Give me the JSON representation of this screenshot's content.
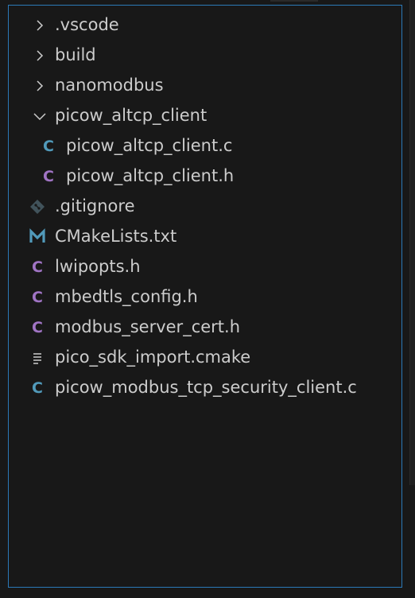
{
  "explorer": {
    "items": [
      {
        "label": ".vscode",
        "kind": "folder",
        "expanded": false,
        "depth": 0,
        "icon": "chevron-right-icon"
      },
      {
        "label": "build",
        "kind": "folder",
        "expanded": false,
        "depth": 0,
        "icon": "chevron-right-icon"
      },
      {
        "label": "nanomodbus",
        "kind": "folder",
        "expanded": false,
        "depth": 0,
        "icon": "chevron-right-icon"
      },
      {
        "label": "picow_altcp_client",
        "kind": "folder",
        "expanded": true,
        "depth": 0,
        "icon": "chevron-down-icon"
      },
      {
        "label": "picow_altcp_client.c",
        "kind": "file",
        "depth": 1,
        "icon": "c-file-icon",
        "icon_color": "#519aba"
      },
      {
        "label": "picow_altcp_client.h",
        "kind": "file",
        "depth": 1,
        "icon": "h-file-icon",
        "icon_color": "#a074c4"
      },
      {
        "label": ".gitignore",
        "kind": "file",
        "depth": 0,
        "icon": "git-icon",
        "icon_color": "#41535b"
      },
      {
        "label": "CMakeLists.txt",
        "kind": "file",
        "depth": 0,
        "icon": "cmake-icon",
        "icon_color": "#519aba"
      },
      {
        "label": "lwipopts.h",
        "kind": "file",
        "depth": 0,
        "icon": "h-file-icon",
        "icon_color": "#a074c4"
      },
      {
        "label": "mbedtls_config.h",
        "kind": "file",
        "depth": 0,
        "icon": "h-file-icon",
        "icon_color": "#a074c4"
      },
      {
        "label": "modbus_server_cert.h",
        "kind": "file",
        "depth": 0,
        "icon": "h-file-icon",
        "icon_color": "#a074c4"
      },
      {
        "label": "pico_sdk_import.cmake",
        "kind": "file",
        "depth": 0,
        "icon": "text-lines-icon",
        "icon_color": "#cccccc"
      },
      {
        "label": "picow_modbus_tcp_security_client.c",
        "kind": "file",
        "depth": 0,
        "icon": "c-file-icon",
        "icon_color": "#519aba"
      }
    ],
    "glyphs": {
      "c_letter": "C",
      "m_letter": "M"
    }
  }
}
